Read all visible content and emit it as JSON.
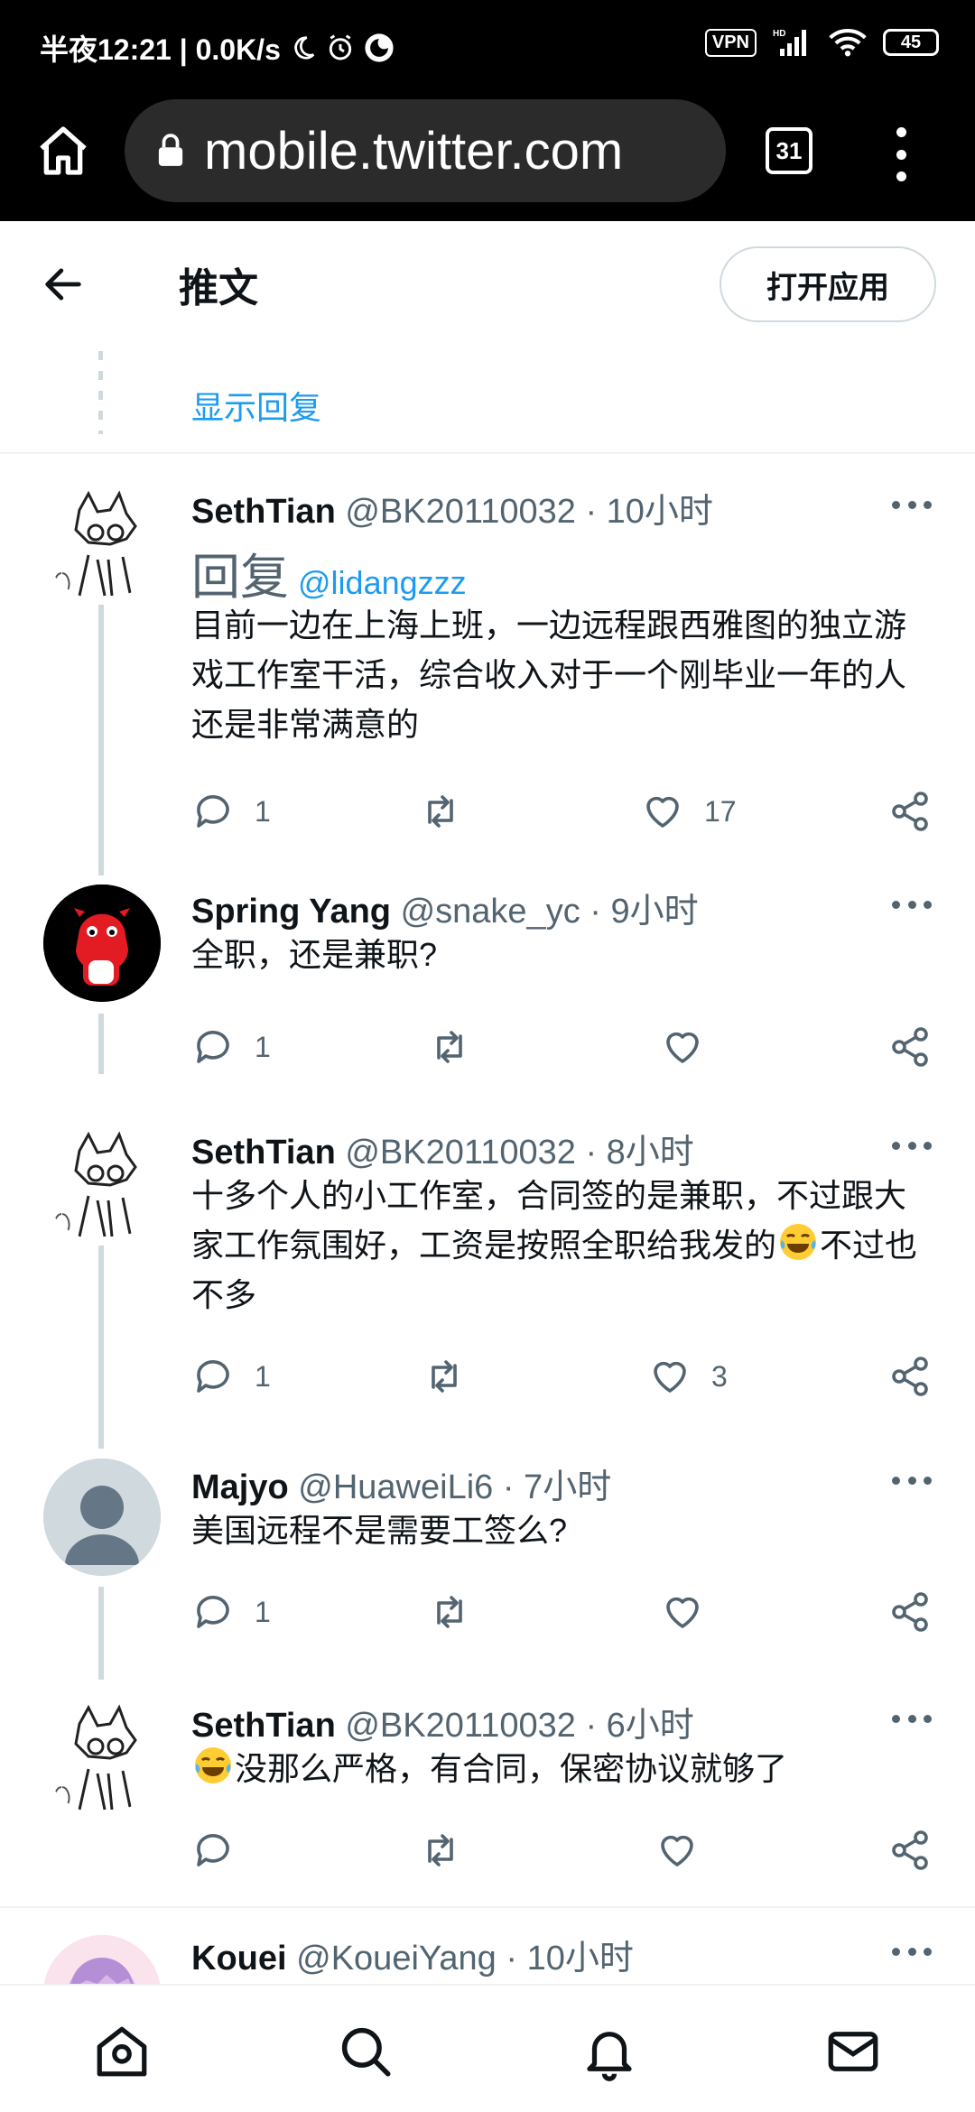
{
  "status_bar": {
    "left_text": "半夜12:21 | 0.0K/s",
    "vpn": "VPN",
    "signal": "HD",
    "battery": "45"
  },
  "browser": {
    "url": "mobile.twitter.com",
    "tab_count": "31"
  },
  "header": {
    "title": "推文",
    "open_app": "打开应用"
  },
  "show_replies": "显示回复",
  "tweets": [
    {
      "name": "SethTian",
      "handle": "@BK20110032",
      "time": "· 10小时",
      "reply_word": "回复",
      "reply_mention": "@lidangzzz",
      "text": "目前一边在上海上班，一边远程跟西雅图的独立游戏工作室干活，综合收入对于一个刚毕业一年的人还是非常满意的",
      "replies": "1",
      "retweets": "",
      "likes": "17"
    },
    {
      "name": "Spring Yang",
      "handle": "@snake_yc",
      "time": "· 9小时",
      "text": "全职，还是兼职?",
      "replies": "1",
      "retweets": "",
      "likes": ""
    },
    {
      "name": "SethTian",
      "handle": "@BK20110032",
      "time": "· 8小时",
      "text": "十多个人的小工作室，合同签的是兼职，不过跟大家工作氛围好，工资是按照全职给我发的",
      "text_tail": "不过也不多",
      "replies": "1",
      "retweets": "",
      "likes": "3"
    },
    {
      "name": "Majyo",
      "handle": "@HuaweiLi6",
      "time": "· 7小时",
      "text": "美国远程不是需要工签么?",
      "replies": "1",
      "retweets": "",
      "likes": ""
    },
    {
      "name": "SethTian",
      "handle": "@BK20110032",
      "time": "· 6小时",
      "text": "没那么严格，有合同，保密协议就够了",
      "replies": "",
      "retweets": "",
      "likes": ""
    },
    {
      "name": "Kouei",
      "handle": "@KoueiYang",
      "time": "· 10小时"
    }
  ],
  "icons": {
    "emoji": "tears-of-joy-emoji",
    "nav": [
      "home-icon",
      "search-icon",
      "notifications-icon",
      "messages-icon"
    ]
  },
  "colors": {
    "link": "#1d9bf0",
    "secondary_text": "#536471",
    "thread_line": "#cfd9de"
  }
}
